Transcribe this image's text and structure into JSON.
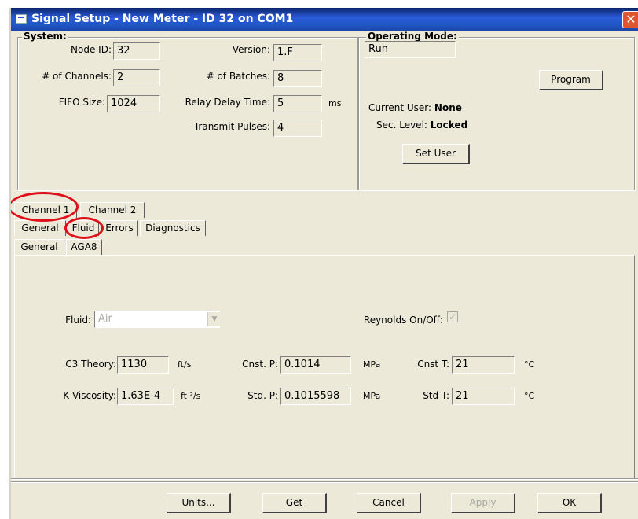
{
  "window": {
    "title": "Signal Setup - New Meter -  ID 32 on COM1",
    "close_glyph": "✕"
  },
  "system": {
    "title": "System:",
    "node_id_label": "Node ID:",
    "node_id": "32",
    "channels_label": "# of Channels:",
    "channels": "2",
    "fifo_label": "FIFO Size:",
    "fifo": "1024",
    "version_label": "Version:",
    "version": "1.F",
    "batches_label": "# of Batches:",
    "batches": "8",
    "relay_label": "Relay Delay Time:",
    "relay": "5",
    "relay_unit": "ms",
    "transmit_label": "Transmit Pulses:",
    "transmit": "4"
  },
  "operating_mode": {
    "title": "Operating Mode:",
    "mode": "Run",
    "program_label": "Program",
    "current_user_label": "Current User:",
    "current_user": "None",
    "sec_level_label": "Sec. Level:",
    "sec_level": "Locked",
    "set_user_label": "Set User"
  },
  "channel_tabs": [
    "Channel 1",
    "Channel 2"
  ],
  "sub_tabs": [
    "General",
    "Fluid",
    "Errors",
    "Diagnostics"
  ],
  "fluid_tabs": [
    "General",
    "AGA8"
  ],
  "fluid": {
    "fluid_label": "Fluid:",
    "fluid_value": "Air",
    "reynolds_label": "Reynolds On/Off:",
    "reynolds_checked": true,
    "c3_label": "C3 Theory:",
    "c3": "1130",
    "c3_unit": "ft/s",
    "kvisc_label": "K Viscosity:",
    "kvisc": "1.63E-4",
    "kvisc_unit": "ft ²/s",
    "cnst_p_label": "Cnst. P:",
    "cnst_p": "0.1014",
    "cnst_p_unit": "MPa",
    "std_p_label": "Std. P:",
    "std_p": "0.1015598",
    "std_p_unit": "MPa",
    "cnst_t_label": "Cnst T:",
    "cnst_t": "21",
    "cnst_t_unit": "°C",
    "std_t_label": "Std T:",
    "std_t": "21",
    "std_t_unit": "°C"
  },
  "buttons": {
    "units": "Units...",
    "get": "Get",
    "cancel": "Cancel",
    "apply": "Apply",
    "ok": "OK"
  },
  "colors": {
    "annotation_red": "#e0101a",
    "titlebar": "#2158c6",
    "dialog": "#ece9d8"
  }
}
